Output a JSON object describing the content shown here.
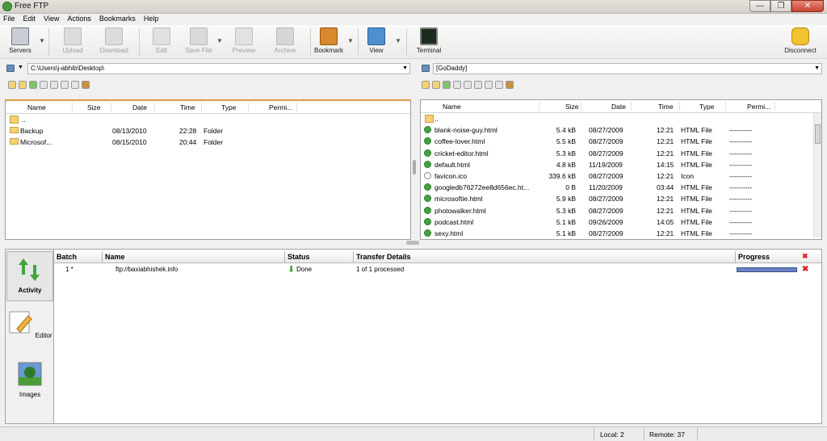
{
  "window": {
    "title": "Free FTP",
    "buttons": [
      "—",
      "❐",
      "✕"
    ]
  },
  "menu": [
    "File",
    "Edit",
    "View",
    "Actions",
    "Bookmarks",
    "Help"
  ],
  "toolbar": {
    "servers": "Servers",
    "upload": "Upload",
    "download": "Download",
    "edit": "Edit",
    "save_file": "Save File",
    "preview": "Preview",
    "archive": "Archive",
    "bookmark": "Bookmark",
    "view": "View",
    "terminal": "Terminal",
    "disconnect": "Disconnect"
  },
  "local": {
    "path": "C:\\Users\\j-abhib\\Desktop\\",
    "columns": [
      "Name",
      "Size",
      "Date",
      "Time",
      "Type",
      "Permi..."
    ],
    "rows": [
      {
        "name": "..",
        "size": "",
        "date": "",
        "time": "",
        "type": ""
      },
      {
        "name": "Backup",
        "size": "",
        "date": "08/13/2010",
        "time": "22:28",
        "type": "Folder"
      },
      {
        "name": "Microsof...",
        "size": "",
        "date": "08/15/2010",
        "time": "20:44",
        "type": "Folder"
      }
    ]
  },
  "remote": {
    "path": "[GoDaddy]",
    "columns": [
      "Name",
      "Size",
      "Date",
      "Time",
      "Type",
      "Permi..."
    ],
    "rows": [
      {
        "name": "..",
        "size": "",
        "date": "",
        "time": "",
        "type": "",
        "perm": ""
      },
      {
        "name": "blank-noise-guy.html",
        "size": "5.4 kB",
        "date": "08/27/2009",
        "time": "12:21",
        "type": "HTML File",
        "perm": "----------"
      },
      {
        "name": "coffee-lover.html",
        "size": "5.5 kB",
        "date": "08/27/2009",
        "time": "12:21",
        "type": "HTML File",
        "perm": "----------"
      },
      {
        "name": "cricket-editor.html",
        "size": "5.3 kB",
        "date": "08/27/2009",
        "time": "12:21",
        "type": "HTML File",
        "perm": "----------"
      },
      {
        "name": "default.html",
        "size": "4.8 kB",
        "date": "11/19/2009",
        "time": "14:15",
        "type": "HTML File",
        "perm": "----------"
      },
      {
        "name": "favicon.ico",
        "size": "339.6 kB",
        "date": "08/27/2009",
        "time": "12:21",
        "type": "Icon",
        "perm": "----------"
      },
      {
        "name": "googledb76272ee8d656ec.ht...",
        "size": "0 B",
        "date": "11/20/2009",
        "time": "03:44",
        "type": "HTML File",
        "perm": "----------"
      },
      {
        "name": "microsoftie.html",
        "size": "5.9 kB",
        "date": "08/27/2009",
        "time": "12:21",
        "type": "HTML File",
        "perm": "----------"
      },
      {
        "name": "photowalker.html",
        "size": "5.3 kB",
        "date": "08/27/2009",
        "time": "12:21",
        "type": "HTML File",
        "perm": "----------"
      },
      {
        "name": "podcast.html",
        "size": "5.1 kB",
        "date": "09/26/2009",
        "time": "14:05",
        "type": "HTML File",
        "perm": "----------"
      },
      {
        "name": "sexy.html",
        "size": "5.1 kB",
        "date": "08/27/2009",
        "time": "12:21",
        "type": "HTML File",
        "perm": "----------"
      }
    ]
  },
  "sidetabs": {
    "activity": "Activity",
    "editor": "Editor",
    "images": "Images"
  },
  "activity": {
    "columns": [
      "Batch",
      "Name",
      "Status",
      "Transfer Details",
      "Progress"
    ],
    "rows": [
      {
        "batch": "1 *",
        "name": "ftp://baxiabhishek.info",
        "status": "Done",
        "details": "1 of 1 processed",
        "progress": 1.0
      }
    ]
  },
  "status": {
    "local": "Local: 2",
    "remote": "Remote: 37"
  }
}
